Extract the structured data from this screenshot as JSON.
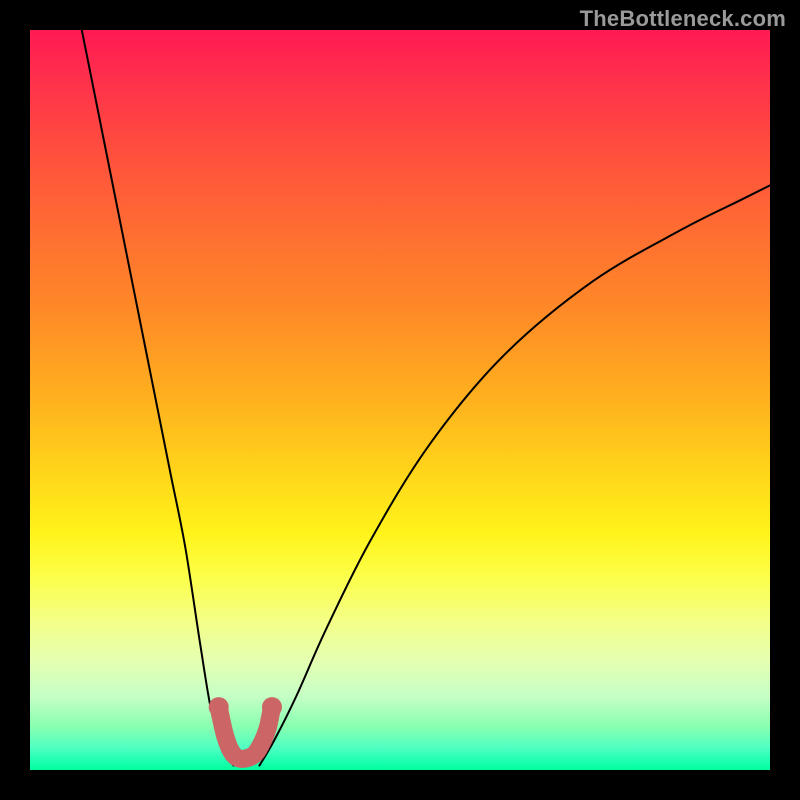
{
  "watermark": "TheBottleneck.com",
  "chart_data": {
    "type": "line",
    "title": "",
    "xlabel": "",
    "ylabel": "",
    "xlim": [
      0,
      100
    ],
    "ylim": [
      0,
      100
    ],
    "grid": false,
    "series": [
      {
        "name": "left-branch",
        "x": [
          7,
          9,
          11,
          13,
          15,
          17,
          19,
          21,
          23,
          24.5,
          26,
          27.5
        ],
        "y": [
          100,
          90,
          80,
          70,
          60,
          50,
          40,
          30,
          17,
          8,
          3,
          0.6
        ]
      },
      {
        "name": "right-branch",
        "x": [
          31,
          33,
          36,
          40,
          46,
          54,
          64,
          76,
          88,
          96,
          100
        ],
        "y": [
          0.6,
          4,
          10,
          19,
          31,
          44,
          56,
          66,
          73,
          77,
          79
        ]
      },
      {
        "name": "marker-u",
        "x": [
          25.5,
          26.4,
          27.4,
          28.6,
          30.2,
          31.2,
          32.1,
          32.7
        ],
        "y": [
          8.5,
          4.5,
          2.2,
          1.5,
          2.0,
          3.4,
          5.6,
          8.5
        ]
      }
    ],
    "gradient_stops": [
      {
        "pos": 0,
        "color": "#ff1a52"
      },
      {
        "pos": 50,
        "color": "#ffb11e"
      },
      {
        "pos": 74,
        "color": "#fcff4a"
      },
      {
        "pos": 100,
        "color": "#00ff99"
      }
    ]
  }
}
